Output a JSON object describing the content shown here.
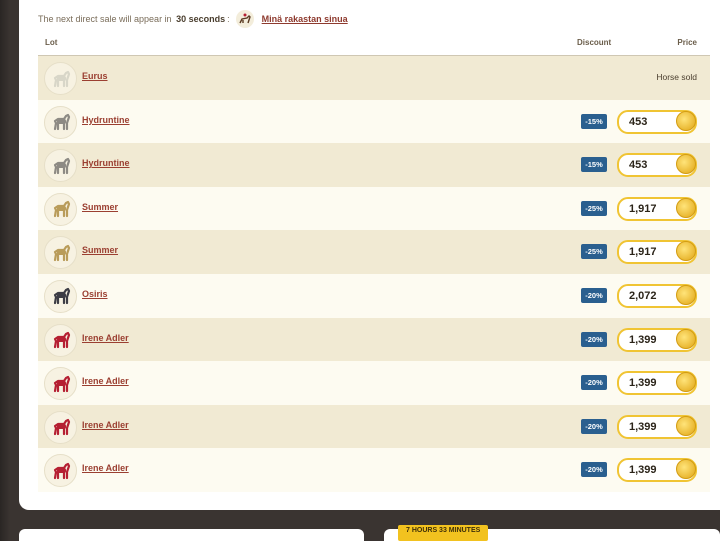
{
  "notice": {
    "prefix": "The next direct sale will appear in",
    "time": "30 seconds",
    "suffix": ":",
    "link": "Minä rakastan sinua"
  },
  "table": {
    "headers": {
      "lot": "Lot",
      "discount": "Discount",
      "price": "Price"
    },
    "rows": [
      {
        "name": "Eurus",
        "discount": "",
        "price": "",
        "status": "Horse sold",
        "icon": "horse-white-icon",
        "coat": "#d8d6c8"
      },
      {
        "name": "Hydruntine",
        "discount": "-15%",
        "price": "453",
        "status": "",
        "icon": "horse-grey-icon",
        "coat": "#8d8a84"
      },
      {
        "name": "Hydruntine",
        "discount": "-15%",
        "price": "453",
        "status": "",
        "icon": "horse-grey-icon",
        "coat": "#8d8a84"
      },
      {
        "name": "Summer",
        "discount": "-25%",
        "price": "1,917",
        "status": "",
        "icon": "horse-dun-icon",
        "coat": "#b99c5a"
      },
      {
        "name": "Summer",
        "discount": "-25%",
        "price": "1,917",
        "status": "",
        "icon": "horse-dun-icon",
        "coat": "#b99c5a"
      },
      {
        "name": "Osiris",
        "discount": "-20%",
        "price": "2,072",
        "status": "",
        "icon": "horse-black-icon",
        "coat": "#3c3c44"
      },
      {
        "name": "Irene Adler",
        "discount": "-20%",
        "price": "1,399",
        "status": "",
        "icon": "horse-red-icon",
        "coat": "#b51f32"
      },
      {
        "name": "Irene Adler",
        "discount": "-20%",
        "price": "1,399",
        "status": "",
        "icon": "horse-red-icon",
        "coat": "#b51f32"
      },
      {
        "name": "Irene Adler",
        "discount": "-20%",
        "price": "1,399",
        "status": "",
        "icon": "horse-red-icon",
        "coat": "#b51f32"
      },
      {
        "name": "Irene Adler",
        "discount": "-20%",
        "price": "1,399",
        "status": "",
        "icon": "horse-red-icon",
        "coat": "#b51f32"
      }
    ]
  },
  "footer": {
    "timer": "7 HOURS 33 MINUTES"
  },
  "colors": {
    "discount_badge": "#2a5f8f",
    "link": "#9b3f31",
    "price_border": "#f0c433",
    "row_alt": "#f1ead3"
  }
}
